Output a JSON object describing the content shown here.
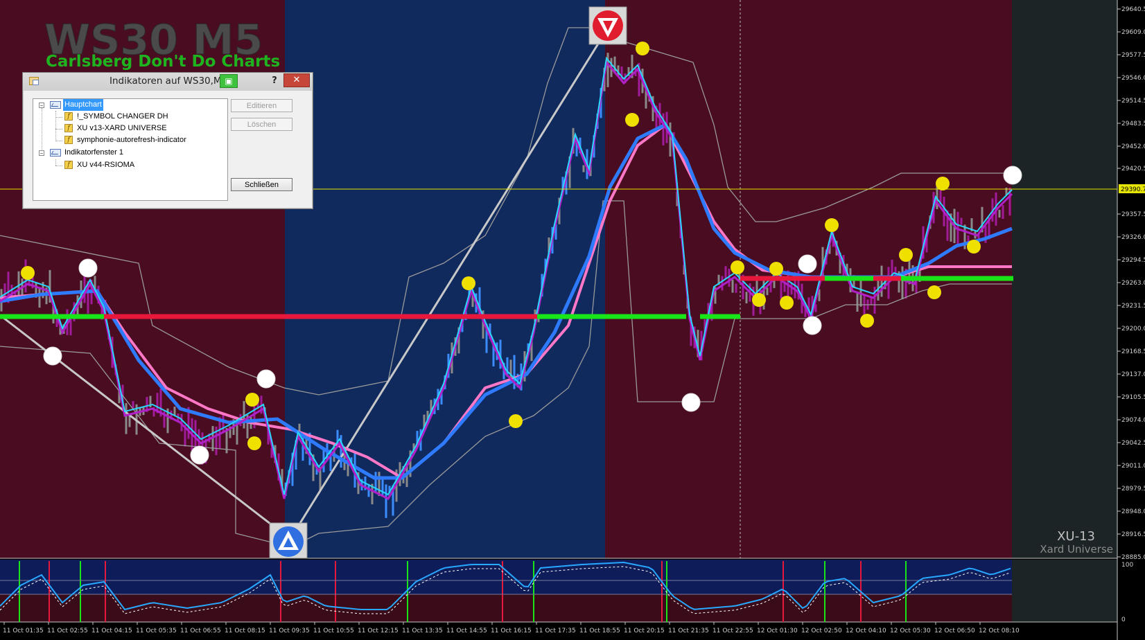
{
  "chart": {
    "symbol_title": "WS30 M5",
    "subtitle": "Carlsberg Don't Do Charts",
    "watermark_title": "XU-13",
    "watermark_subtitle": "Xard Universe",
    "current_price_label": "29390.7",
    "price_axis": [
      "29640.5",
      "29609.0",
      "29577.5",
      "29546.0",
      "29514.5",
      "29483.5",
      "29452.0",
      "29420.5",
      "29357.5",
      "29326.0",
      "29294.5",
      "29263.0",
      "29231.5",
      "29200.0",
      "29168.5",
      "29137.0",
      "29105.5",
      "29074.0",
      "29042.5",
      "29011.0",
      "28979.5",
      "28948.0",
      "28916.5",
      "28885.0"
    ],
    "sub_axis": [
      "100",
      "0"
    ],
    "time_axis": [
      "11 Oct 01:35",
      "11 Oct 02:55",
      "11 Oct 04:15",
      "11 Oct 05:35",
      "11 Oct 06:55",
      "11 Oct 08:15",
      "11 Oct 09:35",
      "11 Oct 10:55",
      "11 Oct 12:15",
      "11 Oct 13:35",
      "11 Oct 14:55",
      "11 Oct 16:15",
      "11 Oct 17:35",
      "11 Oct 18:55",
      "11 Oct 20:15",
      "11 Oct 21:35",
      "11 Oct 22:55",
      "12 Oct 01:30",
      "12 Oct 02:50",
      "12 Oct 04:10",
      "12 Oct 05:30",
      "12 Oct 06:50",
      "12 Oct 08:10"
    ],
    "colors": {
      "bearish_zone": "#4a0c20",
      "bullish_zone": "#112a5e",
      "sub_window_bg": "#0f1c5a",
      "bull_line": "#19e619",
      "bear_line": "#e8183c",
      "fast_line": "#28d8ff",
      "slow_line": "#2f7bff",
      "pink_line": "#ff78c8",
      "price_line": "#e6e600"
    }
  },
  "dialog": {
    "title": "Indikatoren auf WS30,M5",
    "help_label": "?",
    "close_label": "✕",
    "tree": {
      "main_chart": "Hauptchart",
      "main_items": [
        "!_SYMBOL CHANGER DH",
        "XU v13-XARD UNIVERSE",
        "symphonie-autorefresh-indicator"
      ],
      "subwindow": "Indikatorfenster 1",
      "sub_items": [
        "XU v44-RSIOMA"
      ]
    },
    "buttons": {
      "edit": "Editieren",
      "delete": "Löschen",
      "close": "Schließen"
    }
  }
}
